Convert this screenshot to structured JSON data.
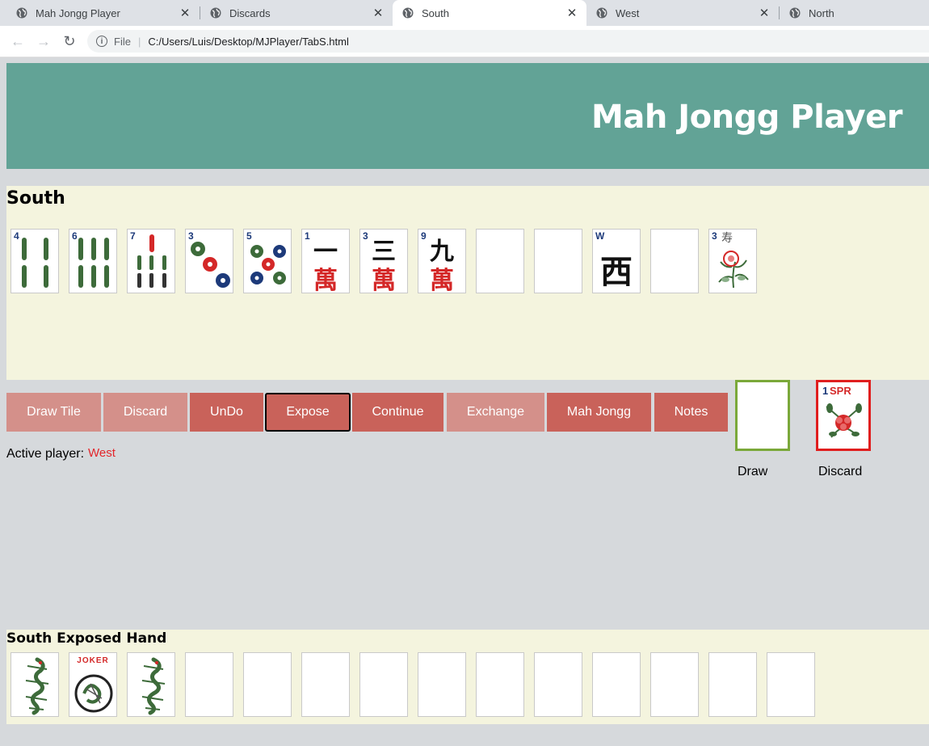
{
  "browser": {
    "tabs": [
      {
        "label": "Mah Jongg Player"
      },
      {
        "label": "Discards"
      },
      {
        "label": "South"
      },
      {
        "label": "West"
      },
      {
        "label": "North"
      }
    ],
    "file_label": "File",
    "url": "C:/Users/Luis/Desktop/MJPlayer/TabS.html"
  },
  "header": {
    "title": "Mah Jongg Player"
  },
  "hand": {
    "title": "South",
    "tiles": [
      {
        "number": "4",
        "suit": "bam"
      },
      {
        "number": "6",
        "suit": "bam"
      },
      {
        "number": "7",
        "suit": "bam"
      },
      {
        "number": "3",
        "suit": "dot"
      },
      {
        "number": "5",
        "suit": "dot"
      },
      {
        "number": "1",
        "suit": "crak",
        "char": "一"
      },
      {
        "number": "3",
        "suit": "crak",
        "char": "三"
      },
      {
        "number": "9",
        "suit": "crak",
        "char": "九"
      },
      {
        "number": "",
        "suit": "blank"
      },
      {
        "number": "",
        "suit": "blank"
      },
      {
        "number": "W",
        "suit": "wind",
        "char": "西"
      },
      {
        "number": "",
        "suit": "blank"
      },
      {
        "number": "3",
        "suit": "flower",
        "char": "寿"
      }
    ],
    "crak_char": "萬"
  },
  "buttons": {
    "draw_tile": "Draw Tile",
    "discard": "Discard",
    "undo": "UnDo",
    "expose": "Expose",
    "continue": "Continue",
    "exchange": "Exchange",
    "mah_jongg": "Mah Jongg",
    "notes": "Notes"
  },
  "status": {
    "active_player_label": "Active player:",
    "active_player": "West"
  },
  "slots": {
    "draw_label": "Draw",
    "discard_label": "Discard",
    "discard_tile_number": "1",
    "discard_tile_text": "SPR"
  },
  "exposed": {
    "title": "South Exposed Hand",
    "joker_text": "JOKER",
    "tiles": [
      "dragon",
      "joker",
      "dragon",
      "blank",
      "blank",
      "blank",
      "blank",
      "blank",
      "blank",
      "blank",
      "blank",
      "blank",
      "blank",
      "blank"
    ]
  },
  "colors": {
    "header": "#62a396",
    "panel": "#f4f4de",
    "button_light": "#d4908a",
    "button_dark": "#c9625a",
    "draw_border": "#7aa83a",
    "discard_border": "#e01e1e",
    "active_player": "#e3262b"
  }
}
